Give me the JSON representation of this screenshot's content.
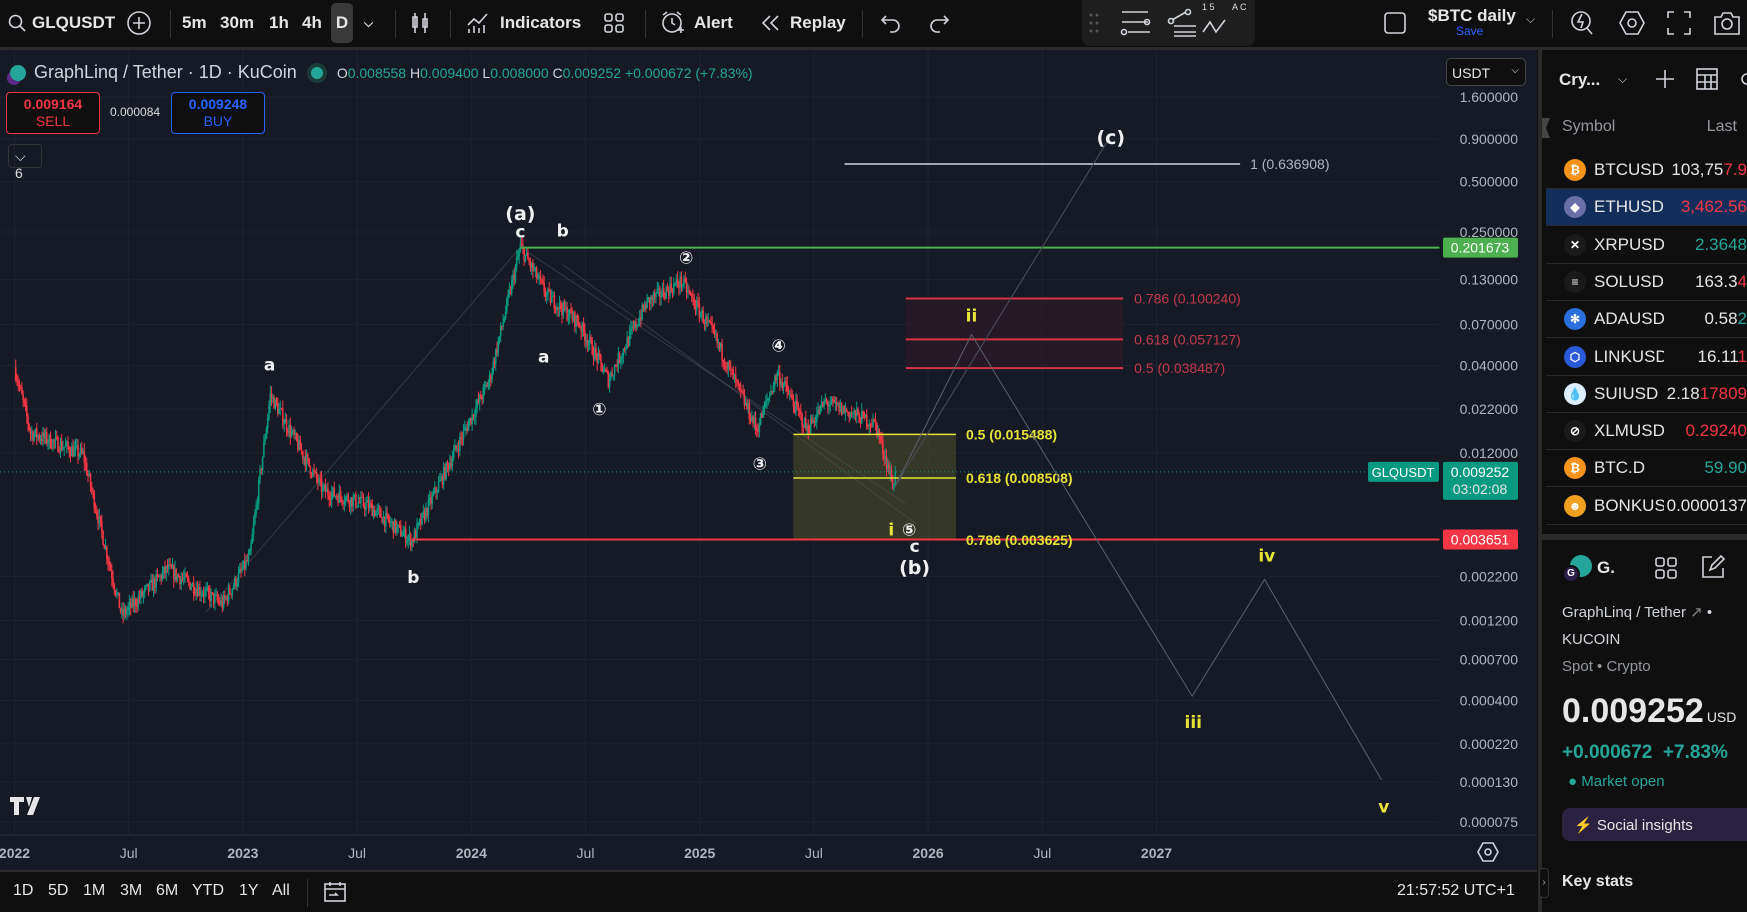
{
  "toolbar": {
    "symbol": "GLQUSDT",
    "intervals": [
      "5m",
      "30m",
      "1h",
      "4h",
      "D"
    ],
    "indicators": "Indicators",
    "alert": "Alert",
    "replay": "Replay",
    "layout_name": "$BTC daily",
    "save": "Save",
    "fib_nums": "1  5",
    "fib_letters": "A  C"
  },
  "legend": {
    "title": "GraphLinq / Tether · 1D · KuCoin",
    "o_label": "O",
    "o": "0.008558",
    "h_label": "H",
    "h": "0.009400",
    "l_label": "L",
    "l": "0.008000",
    "c_label": "C",
    "c": "0.009252",
    "change": "+0.000672 (+7.83%)",
    "sell_price": "0.009164",
    "sell": "SELL",
    "spread": "0.000084",
    "buy_price": "0.009248",
    "buy": "BUY",
    "indicator_count": "6",
    "currency": "USDT"
  },
  "colors": {
    "up": "#089981",
    "down": "#f23645",
    "green_line": "#4caf50",
    "red_line": "#f23645",
    "yellow": "#e8e337",
    "accent": "#2962ff"
  },
  "chart_data": {
    "type": "candlestick",
    "price_scale": "log",
    "path": [
      [
        2022.0,
        0.039
      ],
      [
        2022.07,
        0.0159
      ],
      [
        2022.3,
        0.0117
      ],
      [
        2022.47,
        0.00128
      ],
      [
        2022.67,
        0.00242
      ],
      [
        2022.91,
        0.0015
      ],
      [
        2023.03,
        0.00286
      ],
      [
        2023.12,
        0.0266
      ],
      [
        2023.35,
        0.00717
      ],
      [
        2023.55,
        0.0058
      ],
      [
        2023.74,
        0.00358
      ],
      [
        2023.89,
        0.0096
      ],
      [
        2024.08,
        0.0329
      ],
      [
        2024.215,
        0.203
      ],
      [
        2024.33,
        0.105
      ],
      [
        2024.47,
        0.072
      ],
      [
        2024.6,
        0.0329
      ],
      [
        2024.77,
        0.0954
      ],
      [
        2024.92,
        0.127
      ],
      [
        2025.06,
        0.061
      ],
      [
        2025.25,
        0.0166
      ],
      [
        2025.34,
        0.036
      ],
      [
        2025.47,
        0.0166
      ],
      [
        2025.55,
        0.0241
      ],
      [
        2025.77,
        0.0179
      ],
      [
        2025.85,
        0.0075
      ],
      [
        2025.856,
        0.009252
      ]
    ],
    "price_ticks": [
      "1.600000",
      "0.900000",
      "0.500000",
      "0.250000",
      "0.130000",
      "0.070000",
      "0.040000",
      "0.022000",
      "0.012000",
      "0.002200",
      "0.001200",
      "0.000700",
      "0.000400",
      "0.000220",
      "0.000130",
      "0.000075"
    ],
    "time_ticks": [
      [
        2022.0,
        "2022"
      ],
      [
        2022.5,
        "Jul"
      ],
      [
        2023.0,
        "2023"
      ],
      [
        2023.5,
        "Jul"
      ],
      [
        2024.0,
        "2024"
      ],
      [
        2024.5,
        "Jul"
      ],
      [
        2025.0,
        "2025"
      ],
      [
        2025.5,
        "Jul"
      ],
      [
        2026.0,
        "2026"
      ],
      [
        2026.5,
        "Jul"
      ],
      [
        2027.0,
        "2027"
      ]
    ],
    "hlines": [
      {
        "name": "resistance-line",
        "price": 0.201673,
        "from": 2024.215,
        "color": "#4caf50",
        "tag": "0.201673"
      },
      {
        "name": "support-line",
        "price": 0.003651,
        "from": 2023.741,
        "color": "#f23645",
        "tag": "0.003651"
      }
    ],
    "current": {
      "price": 0.009252,
      "symbol": "GLQUSDT",
      "tag": "0.009252",
      "countdown": "03:02:08"
    },
    "target_line": {
      "price": 0.636908,
      "from": 2025.634,
      "to": 2027.366,
      "label": "1 (0.636908)"
    },
    "fib_red": {
      "from": 2025.902,
      "to": 2026.854,
      "levels": [
        {
          "price": 0.10024,
          "label": "0.786 (0.100240)"
        },
        {
          "price": 0.057127,
          "label": "0.618 (0.057127)"
        },
        {
          "price": 0.038487,
          "label": "0.5 (0.038487)"
        }
      ]
    },
    "fib_yellow": {
      "from": 2025.41,
      "to": 2026.122,
      "levels": [
        {
          "price": 0.015488,
          "label": "0.5 (0.015488)"
        },
        {
          "price": 0.008508,
          "label": "0.618 (0.008508)"
        },
        {
          "price": 0.003625,
          "label": "0.786 (0.003625)"
        }
      ]
    },
    "projection": [
      [
        2025.854,
        0.0075
      ],
      [
        2026.19,
        0.061
      ],
      [
        2027.156,
        0.000424
      ],
      [
        2027.473,
        0.00211
      ],
      [
        2027.985,
        0.000134
      ]
    ],
    "projection_c": [
      [
        2025.854,
        0.0075
      ],
      [
        2026.79,
        0.894
      ]
    ],
    "guides": [
      [
        [
          2022.84,
          0.00135
        ],
        [
          2024.215,
          0.203
        ]
      ],
      [
        [
          2024.215,
          0.203
        ],
        [
          2025.9,
          0.006
        ]
      ],
      [
        [
          2024.4,
          0.16
        ],
        [
          2025.95,
          0.0045
        ]
      ]
    ],
    "wave_labels": [
      {
        "t": "(a)",
        "d": 2024.215,
        "p": 0.321,
        "c": "w"
      },
      {
        "t": "c",
        "d": 2024.215,
        "p": 0.251,
        "c": "w"
      },
      {
        "t": "b",
        "d": 2024.4,
        "p": 0.255,
        "c": "w"
      },
      {
        "t": "a",
        "d": 2023.117,
        "p": 0.0406,
        "c": "w"
      },
      {
        "t": "a",
        "d": 2024.317,
        "p": 0.0452,
        "c": "w"
      },
      {
        "t": "b",
        "d": 2023.746,
        "p": 0.00218,
        "c": "w"
      },
      {
        "t": "②",
        "d": 2024.941,
        "p": 0.1766,
        "c": "w"
      },
      {
        "t": "①",
        "d": 2024.561,
        "p": 0.022,
        "c": "w"
      },
      {
        "t": "③",
        "d": 2025.263,
        "p": 0.0104,
        "c": "w"
      },
      {
        "t": "④",
        "d": 2025.346,
        "p": 0.0526,
        "c": "w"
      },
      {
        "t": "i",
        "d": 2025.839,
        "p": 0.0042,
        "c": "y"
      },
      {
        "t": "⑤",
        "d": 2025.917,
        "p": 0.0042,
        "c": "w"
      },
      {
        "t": "c",
        "d": 2025.941,
        "p": 0.00334,
        "c": "w"
      },
      {
        "t": "(b)",
        "d": 2025.941,
        "p": 0.00246,
        "c": "w"
      },
      {
        "t": "ii",
        "d": 2026.19,
        "p": 0.0796,
        "c": "y"
      },
      {
        "t": "iv",
        "d": 2027.483,
        "p": 0.00292,
        "c": "y"
      },
      {
        "t": "iii",
        "d": 2027.161,
        "p": 0.000298,
        "c": "y"
      },
      {
        "t": "v",
        "d": 2027.995,
        "p": 9.31e-05,
        "c": "y"
      },
      {
        "t": "(c)",
        "d": 2026.8,
        "p": 0.908,
        "c": "w"
      }
    ]
  },
  "bottom": {
    "ranges": [
      "1D",
      "5D",
      "1M",
      "3M",
      "6M",
      "YTD",
      "1Y",
      "All"
    ],
    "clock": "21:57:52 UTC+1"
  },
  "watchlist": {
    "title": "Cry...",
    "col_symbol": "Symbol",
    "col_last": "Last",
    "rows": [
      {
        "sym": "BTCUSD",
        "glyph": "₿",
        "bg": "#f7931a",
        "base": "103,75",
        "chg": "7.9",
        "cc": "#f23645"
      },
      {
        "sym": "ETHUSD",
        "glyph": "◆",
        "bg": "#6a6fa8",
        "base": "",
        "chg": "3,462.56",
        "cc": "#f23645"
      },
      {
        "sym": "XRPUSD",
        "glyph": "✕",
        "bg": "#1a1a1a",
        "base": "",
        "chg": "2.3648",
        "cc": "#26a69a"
      },
      {
        "sym": "SOLUSD",
        "glyph": "≡",
        "bg": "#1a1a1a",
        "base": "163.3",
        "chg": "4",
        "cc": "#f23645"
      },
      {
        "sym": "ADAUSD",
        "glyph": "✻",
        "bg": "#2a6fdb",
        "base": "0.58",
        "chg": "2",
        "cc": "#26a69a"
      },
      {
        "sym": "LINKUSD",
        "glyph": "⬡",
        "bg": "#2a5ada",
        "base": "16.11",
        "chg": "1",
        "cc": "#f23645"
      },
      {
        "sym": "SUIUSD",
        "glyph": "💧",
        "bg": "#dceeff",
        "base": "2.18",
        "chg": "17809",
        "cc": "#f23645"
      },
      {
        "sym": "XLMUSD",
        "glyph": "⊘",
        "bg": "#1a1a1a",
        "base": "",
        "chg": "0.29240",
        "cc": "#f23645"
      },
      {
        "sym": "BTC.D",
        "glyph": "₿",
        "bg": "#f7931a",
        "base": "",
        "chg": "59.90",
        "cc": "#26a69a"
      },
      {
        "sym": "BONKUS",
        "glyph": "☻",
        "bg": "#f0a020",
        "base": "0.0000137",
        "chg": "",
        "cc": "#e6e6e6"
      }
    ]
  },
  "details": {
    "short": "G.",
    "name": "GraphLinq / Tether",
    "exchange": "KUCOIN",
    "type": "Spot • Crypto",
    "price": "0.009252",
    "unit": "USD",
    "change": "+0.000672  +7.83%",
    "status": "Market open",
    "social": "Social insights",
    "key_stats": "Key stats"
  }
}
